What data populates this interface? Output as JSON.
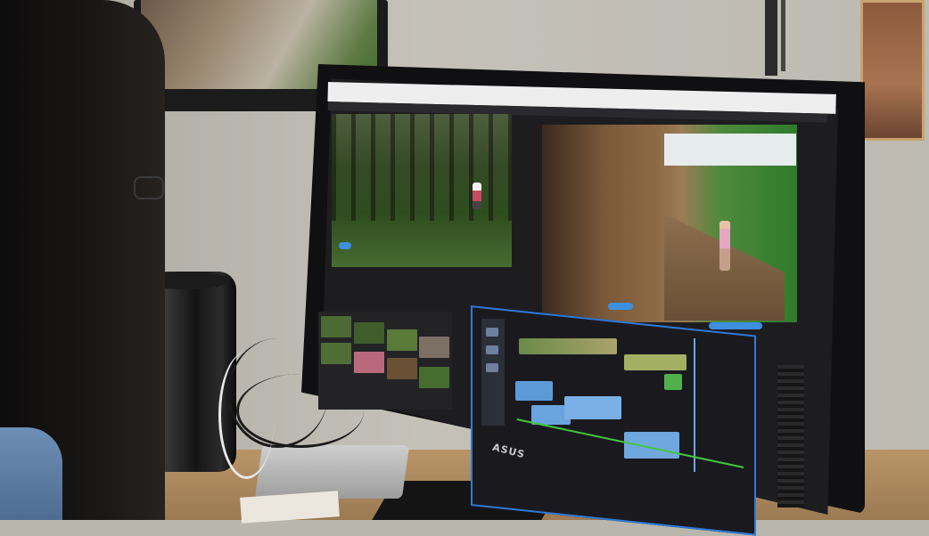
{
  "scene": {
    "monitor_brand": "ASUS"
  },
  "colors": {
    "wall": "#bdbab2",
    "desk": "#b89468",
    "timeline_border": "#2e7ad8",
    "playhead": "#6aa8ff",
    "audio_track_line": "#44c63f"
  },
  "icons": [
    "monitor-icon",
    "timeline-icon"
  ]
}
